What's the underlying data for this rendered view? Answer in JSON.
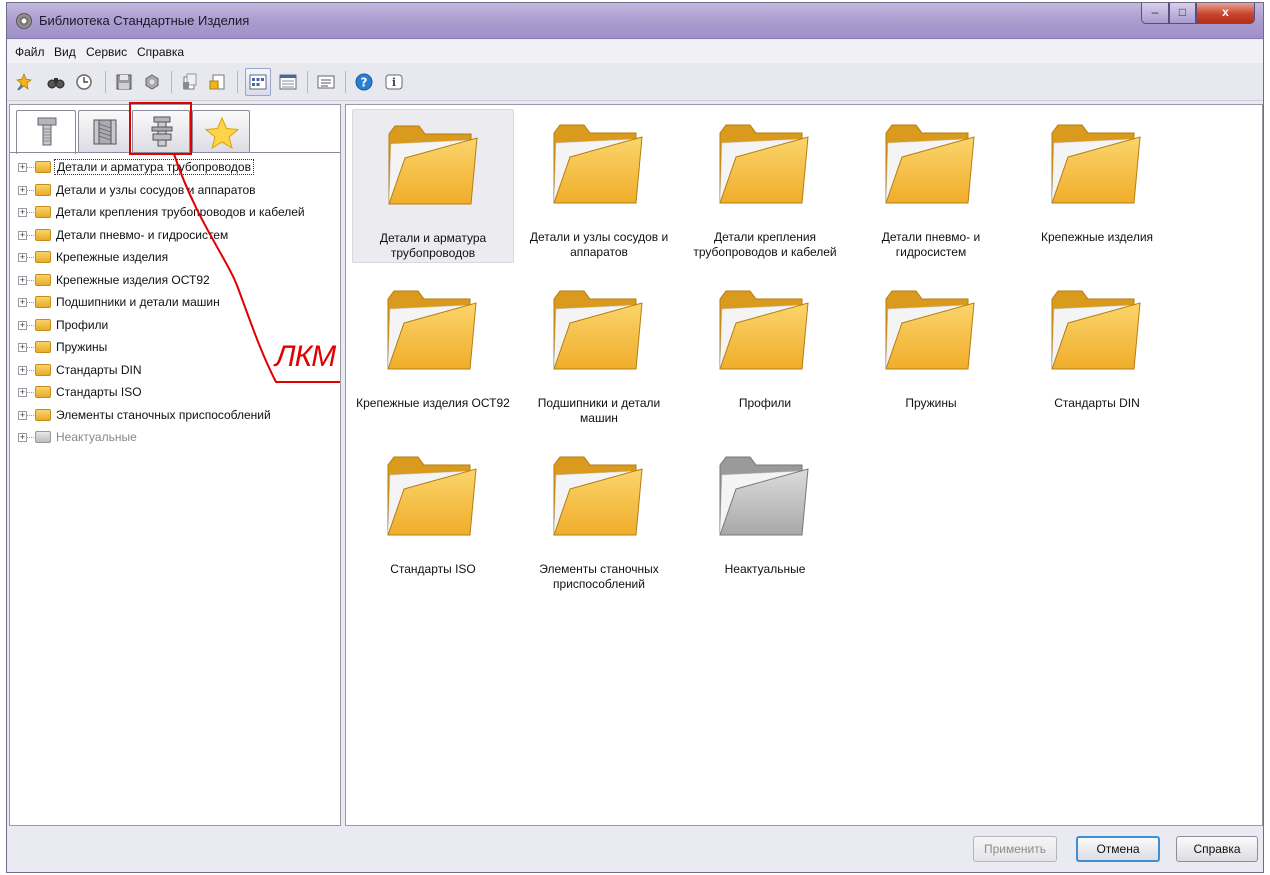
{
  "window": {
    "title": "Библиотека Стандартные Изделия",
    "controls": {
      "minimize": "–",
      "maximize": "□",
      "close": "x"
    }
  },
  "menu": [
    "Файл",
    "Вид",
    "Сервис",
    "Справка"
  ],
  "toolbar_icons": [
    "pin-icon",
    "binoculars-icon",
    "clock-icon",
    "save-icon",
    "nut-icon",
    "copy-document-icon",
    "export-document-icon",
    "large-icons-view-icon",
    "small-icons-view-icon",
    "list-view-icon",
    "help-icon",
    "info-icon"
  ],
  "tabs": [
    "bolt-tab-icon",
    "nut-tab-icon",
    "fastener-assembly-tab-icon",
    "star-tab-icon"
  ],
  "tree": [
    {
      "label": "Детали и арматура трубопроводов",
      "selected": true
    },
    {
      "label": "Детали и узлы сосудов и аппаратов"
    },
    {
      "label": "Детали крепления трубопроводов и кабелей"
    },
    {
      "label": "Детали пневмо- и гидросистем"
    },
    {
      "label": "Крепежные изделия"
    },
    {
      "label": "Крепежные изделия ОСТ92"
    },
    {
      "label": "Подшипники и детали машин"
    },
    {
      "label": "Профили"
    },
    {
      "label": "Пружины"
    },
    {
      "label": "Стандарты DIN"
    },
    {
      "label": "Стандарты ISO"
    },
    {
      "label": "Элементы станочных приспособлений"
    },
    {
      "label": "Неактуальные",
      "inactive": true
    }
  ],
  "folders": [
    {
      "label": "Детали и арматура трубопроводов",
      "selected": true
    },
    {
      "label": "Детали и узлы сосудов и аппаратов"
    },
    {
      "label": "Детали крепления трубопроводов и кабелей"
    },
    {
      "label": "Детали пневмо- и гидросистем"
    },
    {
      "label": "Крепежные изделия"
    },
    {
      "label": "Крепежные изделия ОСТ92"
    },
    {
      "label": "Подшипники и детали машин"
    },
    {
      "label": "Профили"
    },
    {
      "label": "Пружины"
    },
    {
      "label": "Стандарты DIN"
    },
    {
      "label": "Стандарты ISO"
    },
    {
      "label": "Элементы станочных приспособлений"
    },
    {
      "label": "Неактуальные",
      "inactive": true
    }
  ],
  "buttons": {
    "apply": "Применить",
    "cancel": "Отмена",
    "help": "Справка"
  },
  "annotation": {
    "text": "ЛКМ",
    "color": "#e00000"
  },
  "colors": {
    "folder": "#f0b93a",
    "folder_inactive": "#bdbdbd",
    "title_bar": "#ad9fd0"
  }
}
